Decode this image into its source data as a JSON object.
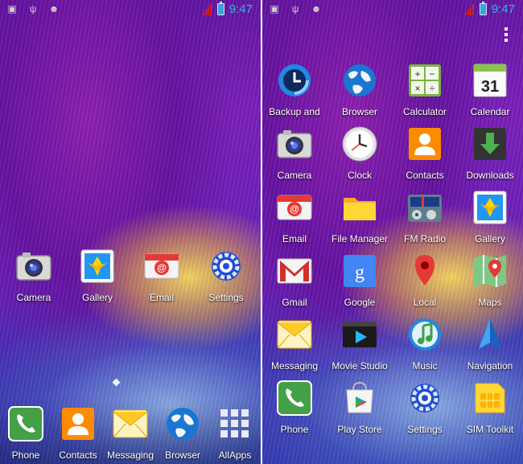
{
  "status_bar": {
    "time": "9:47",
    "left_icons": [
      "image-notification-icon",
      "usb-icon",
      "android-debug-icon"
    ]
  },
  "left_screen": {
    "home_apps": [
      {
        "label": "Camera",
        "icon": "camera-icon"
      },
      {
        "label": "Gallery",
        "icon": "gallery-icon"
      },
      {
        "label": "Email",
        "icon": "email-icon"
      },
      {
        "label": "Settings",
        "icon": "settings-icon"
      }
    ],
    "dock": [
      {
        "label": "Phone",
        "icon": "phone-icon"
      },
      {
        "label": "Contacts",
        "icon": "contacts-icon"
      },
      {
        "label": "Messaging",
        "icon": "messaging-icon"
      },
      {
        "label": "Browser",
        "icon": "browser-icon"
      },
      {
        "label": "AllApps",
        "icon": "all-apps-icon"
      }
    ]
  },
  "right_screen": {
    "apps": [
      {
        "label": "Backup and",
        "icon": "backup-icon"
      },
      {
        "label": "Browser",
        "icon": "browser-icon"
      },
      {
        "label": "Calculator",
        "icon": "calculator-icon"
      },
      {
        "label": "Calendar",
        "icon": "calendar-icon",
        "day": "31"
      },
      {
        "label": "Camera",
        "icon": "camera-icon"
      },
      {
        "label": "Clock",
        "icon": "clock-icon"
      },
      {
        "label": "Contacts",
        "icon": "contacts-icon"
      },
      {
        "label": "Downloads",
        "icon": "downloads-icon"
      },
      {
        "label": "Email",
        "icon": "email-icon"
      },
      {
        "label": "File Manager",
        "icon": "file-manager-icon"
      },
      {
        "label": "FM Radio",
        "icon": "fm-radio-icon"
      },
      {
        "label": "Gallery",
        "icon": "gallery-icon"
      },
      {
        "label": "Gmail",
        "icon": "gmail-icon"
      },
      {
        "label": "Google",
        "icon": "google-icon"
      },
      {
        "label": "Local",
        "icon": "local-icon"
      },
      {
        "label": "Maps",
        "icon": "maps-icon"
      },
      {
        "label": "Messaging",
        "icon": "messaging-icon"
      },
      {
        "label": "Movie Studio",
        "icon": "movie-studio-icon"
      },
      {
        "label": "Music",
        "icon": "music-icon"
      },
      {
        "label": "Navigation",
        "icon": "navigation-icon"
      },
      {
        "label": "Phone",
        "icon": "phone-icon"
      },
      {
        "label": "Play Store",
        "icon": "play-store-icon"
      },
      {
        "label": "Settings",
        "icon": "settings-icon"
      },
      {
        "label": "SIM Toolkit",
        "icon": "sim-toolkit-icon"
      }
    ]
  },
  "colors": {
    "clock_accent": "#33b5e5",
    "wallpaper_purple": "#7a1fb8",
    "wallpaper_blue": "#2a3cb0"
  }
}
